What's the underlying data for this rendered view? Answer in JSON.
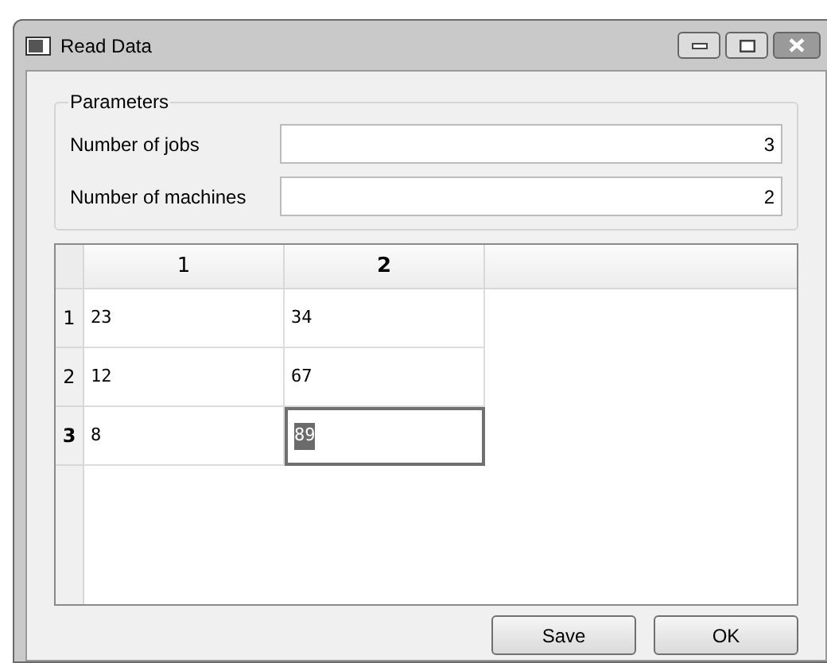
{
  "window": {
    "title": "Read Data"
  },
  "parameters": {
    "title": "Parameters",
    "fields": [
      {
        "label": "Number of jobs",
        "value": "3"
      },
      {
        "label": "Number of machines",
        "value": "2"
      }
    ]
  },
  "table": {
    "columns": [
      {
        "label": "1",
        "selected": false
      },
      {
        "label": "2",
        "selected": true
      }
    ],
    "rows": [
      {
        "label": "1",
        "selected": false,
        "cells": [
          {
            "value": "23",
            "editing": false
          },
          {
            "value": "34",
            "editing": false
          }
        ]
      },
      {
        "label": "2",
        "selected": false,
        "cells": [
          {
            "value": "12",
            "editing": false
          },
          {
            "value": "67",
            "editing": false
          }
        ]
      },
      {
        "label": "3",
        "selected": true,
        "cells": [
          {
            "value": "8",
            "editing": false
          },
          {
            "value": "89",
            "editing": true
          }
        ]
      }
    ]
  },
  "buttons": [
    "Save",
    "OK"
  ]
}
